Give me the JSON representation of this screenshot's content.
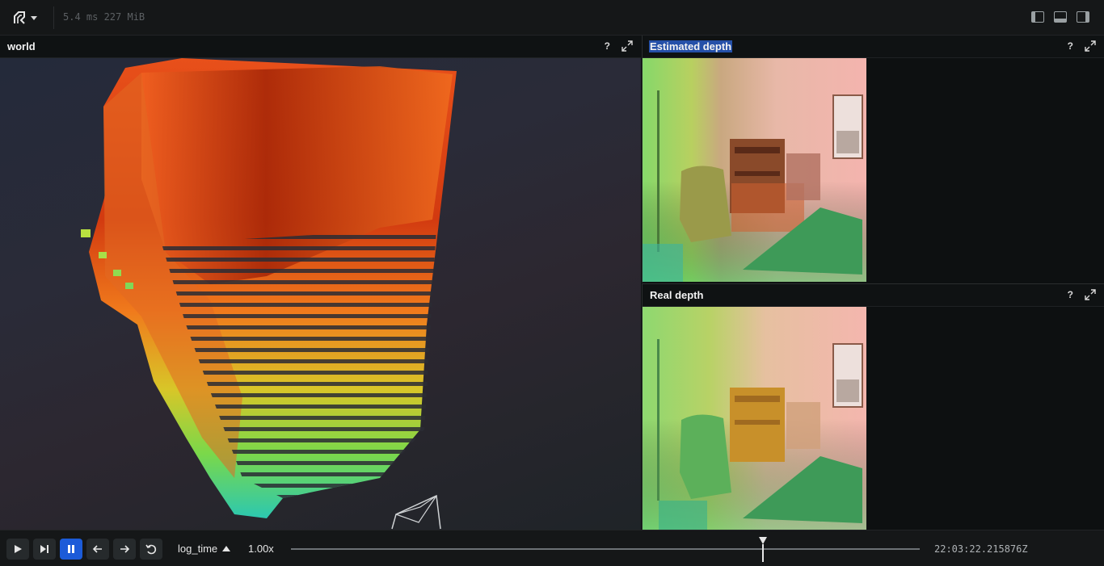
{
  "app": {
    "perf_text": "5.4 ms 227 MiB",
    "logo_icon": "rerun-logo-icon",
    "layout_icons": [
      "left-panel-toggle-icon",
      "bottom-panel-toggle-icon",
      "right-panel-toggle-icon"
    ]
  },
  "panels": {
    "world": {
      "title": "world",
      "help": "?",
      "selected": false
    },
    "estimated": {
      "title": "Estimated depth",
      "help": "?",
      "selected": true
    },
    "real": {
      "title": "Real depth",
      "help": "?",
      "selected": false
    }
  },
  "timeline": {
    "controls": [
      "play-icon",
      "step-end-icon",
      "pause-icon",
      "arrow-left-icon",
      "arrow-right-icon",
      "loop-icon"
    ],
    "active_control": "pause-icon",
    "timeline_name": "log_time",
    "speed": "1.00x",
    "current_time": "22:03:22.215876Z",
    "playhead_fraction": 0.75
  },
  "colors": {
    "accent": "#1c5bd8",
    "selection": "#2550a8",
    "background": "#0d1011"
  }
}
